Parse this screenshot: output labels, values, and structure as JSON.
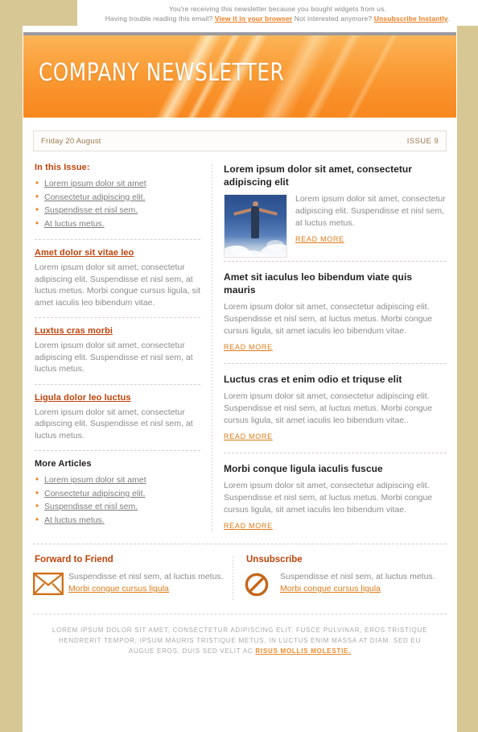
{
  "preheader": {
    "line1": "You're receiving this newsletter because you bought widgets from us.",
    "line2_a": "Having trouble reading this email?",
    "line2_link1": "View it in your browser",
    "line2_b": "Not interested anymore?",
    "line2_link2": "Unsubscribe Instantly",
    "line2_c": "."
  },
  "banner": {
    "title": "Company Newsletter"
  },
  "datebar": {
    "date": "Friday  20 August",
    "issue": "ISSUE 9"
  },
  "sidebar": {
    "in_this_issue_title": "In this Issue:",
    "in_this_issue": [
      "Lorem ipsum dolor sit amet",
      "Consectetur adipiscing elit.",
      "Suspendisse et nisl sem.",
      "At luctus metus."
    ],
    "articles": [
      {
        "title": "Amet dolor sit vitae leo",
        "body": "Lorem ipsum dolor sit amet, consectetur adipiscing elit. Suspendisse et nisl sem, at luctus metus. Morbi congue cursus ligula, sit amet iaculis leo bibendum vitae."
      },
      {
        "title": "Luxtus cras morbi",
        "body": "Lorem ipsum dolor sit amet, consectetur adipiscing elit. Suspendisse et nisl sem, at luctus metus."
      },
      {
        "title": "Ligula dolor leo luctus",
        "body": "Lorem ipsum dolor sit amet, consectetur adipiscing elit. Suspendisse et nisl sem, at luctus metus."
      }
    ],
    "more_articles_title": "More Articles",
    "more_articles": [
      "Lorem ipsum dolor sit amet",
      "Consectetur adipiscing elit.",
      "Suspendisse et nisl sem.",
      "At luctus metus."
    ]
  },
  "main": {
    "read_more_label": "READ MORE",
    "articles": [
      {
        "title": "Lorem ipsum dolor sit amet, consectetur adipiscing elit",
        "body": "Lorem ipsum dolor sit amet, consectetur adipiscing elit. Suspendisse et nisl sem, at luctus metus.",
        "has_image": true,
        "image_alt": "person with outstretched arms above clouds"
      },
      {
        "title": "Amet sit iaculus leo bibendum viate quis mauris",
        "body": "Lorem ipsum dolor sit amet, consectetur adipiscing elit. Suspendisse et nisl sem, at luctus metus. Morbi congue cursus ligula, sit amet iaculis leo bibendum vitae.",
        "has_image": false
      },
      {
        "title": "Luctus cras et enim odio et triquse elit",
        "body": "Lorem ipsum dolor sit amet, consectetur adipiscing elit. Suspendisse et nisl sem, at luctus metus. Morbi congue cursus ligula, sit amet iaculis leo bibendum vitae..",
        "has_image": false
      },
      {
        "title": "Morbi conque ligula iaculis fuscue",
        "body": "Lorem ipsum dolor sit amet, consectetur adipiscing elit. Suspendisse et nisl sem, at luctus metus. Morbi congue cursus ligula, sit amet iaculis leo bibendum vitae.",
        "has_image": false
      }
    ]
  },
  "footer_actions": {
    "forward": {
      "title": "Forward to Friend",
      "icon": "envelope-icon",
      "text": "Suspendisse et nisl sem, at luctus metus.",
      "link": "Morbi congue cursus ligula"
    },
    "unsubscribe": {
      "title": "Unsubscribe",
      "icon": "no-entry-icon",
      "text": "Suspendisse et nisl sem, at luctus metus.",
      "link": "Morbi congue cursus ligula"
    }
  },
  "legal": {
    "text": "LOREM IPSUM DOLOR SIT AMET, CONSECTETUR ADIPISCING ELIT. FUSCE PULVINAR, EROS TRISTIQUE HENDRERIT TEMPOR, IPSUM MAURIS TRISTIQUE METUS, IN LUCTUS ENIM MASSA AT DIAM. SED EU AUGUE EROS. DUIS SED VELIT AC ",
    "link": "RISUS MOLLIS MOLESTIE.",
    "tail": ""
  },
  "colors": {
    "page_bg": "#d7c795",
    "banner_orange": "#f9902a",
    "accent_orange": "#e07b18",
    "heading_rust": "#c0440b",
    "body_gray": "#8c8c8c"
  }
}
